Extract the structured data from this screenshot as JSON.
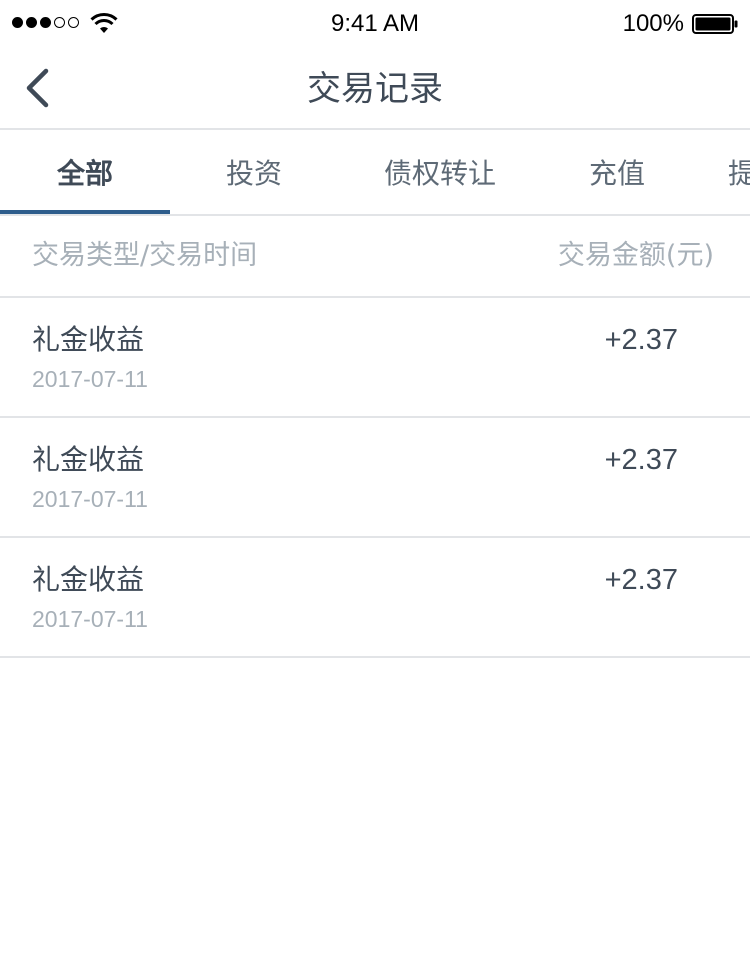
{
  "status_bar": {
    "time": "9:41 AM",
    "battery_percent": "100%",
    "signal_bars_filled": 3,
    "signal_bars_total": 5,
    "battery_level": 1.0
  },
  "nav": {
    "title": "交易记录",
    "back_icon": "chevron-left-icon"
  },
  "tabs": [
    {
      "label": "全部",
      "active": true
    },
    {
      "label": "投资",
      "active": false
    },
    {
      "label": "债权转让",
      "active": false
    },
    {
      "label": "充值",
      "active": false
    },
    {
      "label": "提现",
      "active": false
    }
  ],
  "list_header": {
    "left": "交易类型/交易时间",
    "right": "交易金额(元)"
  },
  "transactions": [
    {
      "type": "礼金收益",
      "date": "2017-07-11",
      "amount": "+2.37"
    },
    {
      "type": "礼金收益",
      "date": "2017-07-11",
      "amount": "+2.37"
    },
    {
      "type": "礼金收益",
      "date": "2017-07-11",
      "amount": "+2.37"
    }
  ],
  "colors": {
    "accent": "#2e5d8c",
    "text_primary": "#3f4a57",
    "text_secondary": "#a7b0b8",
    "divider": "#e2e4e7"
  }
}
